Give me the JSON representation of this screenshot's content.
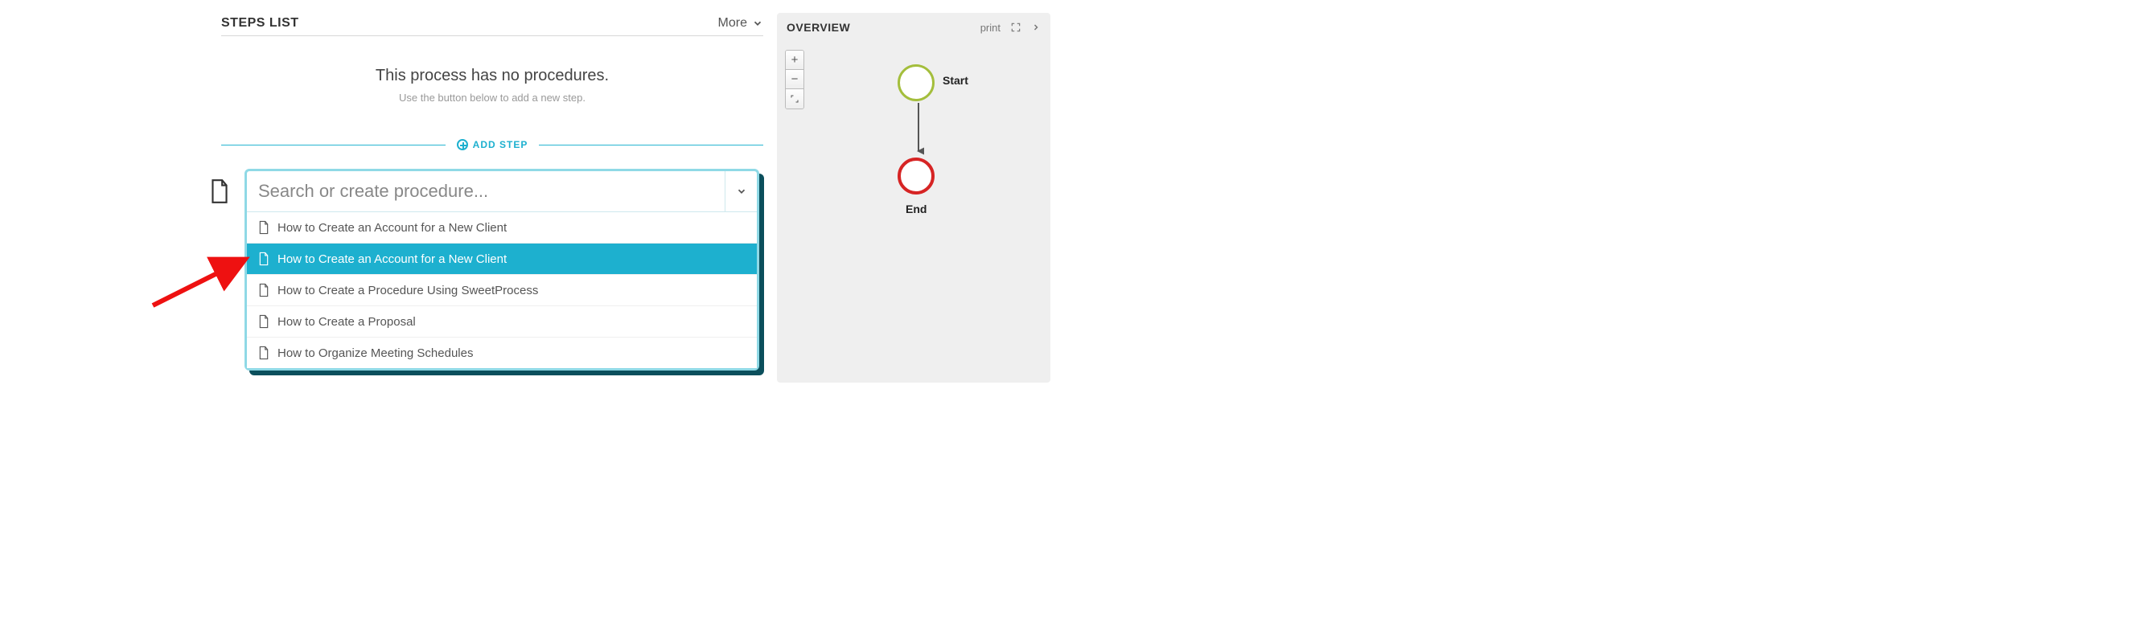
{
  "steps": {
    "title": "STEPS LIST",
    "more_label": "More",
    "empty_title": "This process has no procedures.",
    "empty_sub": "Use the button below to add a new step.",
    "add_step_label": "ADD STEP"
  },
  "search": {
    "placeholder": "Search or create procedure...",
    "selected_index": 1,
    "items": [
      {
        "label": "How to Create an Account for a New Client"
      },
      {
        "label": "How to Create an Account for a New Client"
      },
      {
        "label": "How to Create a Procedure Using SweetProcess"
      },
      {
        "label": "How to Create a Proposal"
      },
      {
        "label": "How to Organize Meeting Schedules"
      }
    ]
  },
  "overview": {
    "title": "OVERVIEW",
    "print_label": "print",
    "nodes": {
      "start_label": "Start",
      "end_label": "End"
    },
    "zoom": {
      "in": "+",
      "out": "−",
      "fit": "⤢"
    }
  },
  "colors": {
    "accent": "#1db0cf",
    "start_node": "#a4be3c",
    "end_node": "#d62424",
    "annotation_arrow": "#e11"
  }
}
